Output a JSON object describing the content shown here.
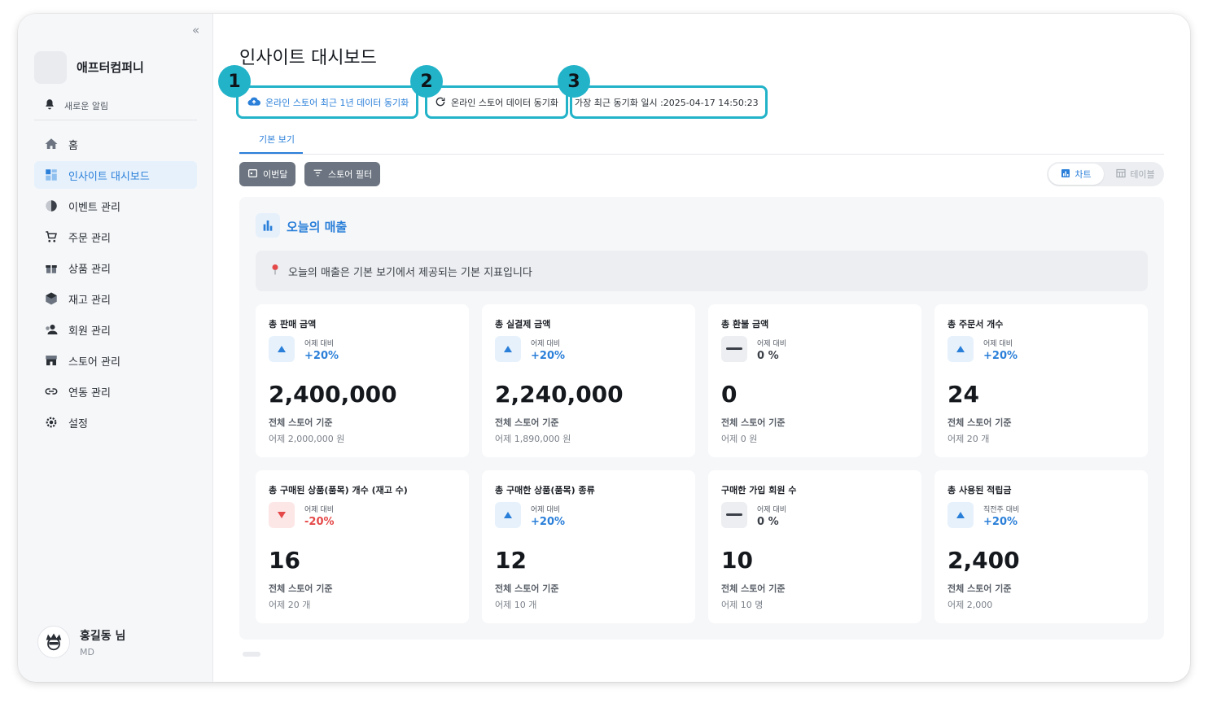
{
  "brand": {
    "name": "애프터컴퍼니"
  },
  "notification": {
    "label": "새로운 알림"
  },
  "nav": [
    {
      "label": "홈",
      "icon": "home-icon",
      "active": false
    },
    {
      "label": "인사이트 대시보드",
      "icon": "dashboard-icon",
      "active": true
    },
    {
      "label": "이벤트 관리",
      "icon": "pie-chart-icon",
      "active": false
    },
    {
      "label": "주문 관리",
      "icon": "cart-icon",
      "active": false
    },
    {
      "label": "상품 관리",
      "icon": "gift-icon",
      "active": false
    },
    {
      "label": "재고 관리",
      "icon": "box-icon",
      "active": false
    },
    {
      "label": "회원 관리",
      "icon": "users-icon",
      "active": false
    },
    {
      "label": "스토어 관리",
      "icon": "store-icon",
      "active": false
    },
    {
      "label": "연동 관리",
      "icon": "link-icon",
      "active": false
    },
    {
      "label": "설정",
      "icon": "settings-icon",
      "active": false
    }
  ],
  "user": {
    "name": "홍길동 님",
    "role": "MD"
  },
  "page": {
    "title": "인사이트 대시보드"
  },
  "sync": {
    "sync_1y_label": "온라인 스토어 최근 1년 데이터 동기화",
    "sync_label": "온라인 스토어 데이터 동기화",
    "last_sync_label": "가장 최근 동기화 일시 :2025-04-17 14:50:23",
    "callouts": [
      "1",
      "2",
      "3"
    ]
  },
  "tabs": {
    "active": "기본 보기"
  },
  "filters": {
    "month": "이번달",
    "store": "스토어 필터"
  },
  "view_toggle": {
    "chart": "차트",
    "table": "테이블"
  },
  "section": {
    "title": "오늘의 매출",
    "info": "오늘의 매출은 기본 보기에서 제공되는 기본 지표입니다"
  },
  "cards": [
    {
      "title": "총 판매 금액",
      "cmp_label": "어제 대비",
      "cmp_value": "+20%",
      "trend": "up",
      "value": "2,400,000",
      "basis": "전체 스토어 기준",
      "prev": "어제 2,000,000 원"
    },
    {
      "title": "총 실결제 금액",
      "cmp_label": "어제 대비",
      "cmp_value": "+20%",
      "trend": "up",
      "value": "2,240,000",
      "basis": "전체 스토어 기준",
      "prev": "어제 1,890,000 원"
    },
    {
      "title": "총 환불 금액",
      "cmp_label": "어제 대비",
      "cmp_value": "0 %",
      "trend": "flat",
      "value": "0",
      "basis": "전체 스토어 기준",
      "prev": "어제 0 원"
    },
    {
      "title": "총 주문서 개수",
      "cmp_label": "어제 대비",
      "cmp_value": "+20%",
      "trend": "up",
      "value": "24",
      "basis": "전체 스토어 기준",
      "prev": "어제 20 개"
    },
    {
      "title": "총 구매된 상품(품목) 개수 (재고 수)",
      "cmp_label": "어제 대비",
      "cmp_value": "-20%",
      "trend": "down",
      "value": "16",
      "basis": "전체 스토어 기준",
      "prev": "어제 20 개"
    },
    {
      "title": "총 구매한 상품(품목) 종류",
      "cmp_label": "어제 대비",
      "cmp_value": "+20%",
      "trend": "up",
      "value": "12",
      "basis": "전체 스토어 기준",
      "prev": "어제 10 개"
    },
    {
      "title": "구매한 가입 회원 수",
      "cmp_label": "어제 대비",
      "cmp_value": "0 %",
      "trend": "flat",
      "value": "10",
      "basis": "전체 스토어 기준",
      "prev": "어제 10 명"
    },
    {
      "title": "총 사용된 적립금",
      "cmp_label": "직전주 대비",
      "cmp_value": "+20%",
      "trend": "up",
      "value": "2,400",
      "basis": "전체 스토어 기준",
      "prev": "어제 2,000"
    }
  ],
  "colors": {
    "accent": "#2a7fd9",
    "highlight": "#22b3c9",
    "down": "#e54848"
  }
}
